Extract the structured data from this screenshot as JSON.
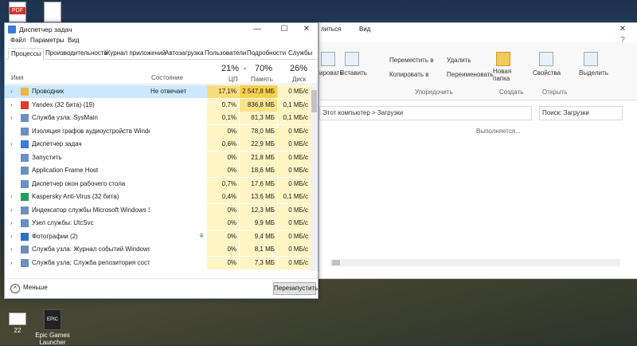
{
  "desktop": {
    "icons": [
      {
        "label": ""
      },
      {
        "label": ""
      },
      {
        "label": "22"
      },
      {
        "label": "Epic Games Launcher"
      }
    ]
  },
  "explorer": {
    "menu": {
      "file_tab": "литься",
      "view_tab": "Вид"
    },
    "ribbon": {
      "copy_path": "ировать",
      "paste": "Вставить",
      "move_to": "Переместить в",
      "copy_to": "Копировать в",
      "delete": "Удалить",
      "rename": "Переименовать",
      "new_folder": "Новая папка",
      "properties": "Свойства",
      "select": "Выделить",
      "group_organize": "Упорядочить",
      "group_create": "Создать",
      "group_open": "Открыть"
    },
    "address": "Этот компьютер  >  Загрузки",
    "search_placeholder": "Поиск: Загрузки",
    "status": "Выполняется..."
  },
  "taskmanager": {
    "title": "Диспетчер задач",
    "menu": [
      "Файл",
      "Параметры",
      "Вид"
    ],
    "tabs": [
      "Процессы",
      "Производительность",
      "Журнал приложений",
      "Автозагрузка",
      "Пользователи",
      "Подробности",
      "Службы"
    ],
    "columns": {
      "name": "Имя",
      "state": "Состояние",
      "cpu_pct": "21%",
      "cpu": "ЦП",
      "mem_pct": "70%",
      "mem": "Память",
      "disk_pct": "26%",
      "disk": "Диск"
    },
    "rows": [
      {
        "name": "Проводник",
        "state": "Не отвечает",
        "cpu": "17,1%",
        "mem": "2 547,8 МБ",
        "disk": "0 МБ/с",
        "arrow": "›",
        "color": "#e8b93a"
      },
      {
        "name": "Yandex (32 бита) (19)",
        "state": "",
        "cpu": "0,7%",
        "mem": "836,8 МБ",
        "disk": "0,1 МБ/с",
        "arrow": "›",
        "color": "#e03c2c"
      },
      {
        "name": "Служба узла: SysMain",
        "state": "",
        "cpu": "0,1%",
        "mem": "81,3 МБ",
        "disk": "0,1 МБ/с",
        "arrow": "›",
        "color": "#6b8fbf"
      },
      {
        "name": "Изоляция графов аудиоустройств Windows",
        "state": "",
        "cpu": "0%",
        "mem": "78,0 МБ",
        "disk": "0 МБ/с",
        "arrow": "",
        "color": "#6b8fbf"
      },
      {
        "name": "Диспетчер задач",
        "state": "",
        "cpu": "0,6%",
        "mem": "22,9 МБ",
        "disk": "0 МБ/с",
        "arrow": "›",
        "color": "#3a7bd5"
      },
      {
        "name": "Запустить",
        "state": "",
        "cpu": "0%",
        "mem": "21,8 МБ",
        "disk": "0 МБ/с",
        "arrow": "",
        "color": "#6b8fbf"
      },
      {
        "name": "Application Frame Host",
        "state": "",
        "cpu": "0%",
        "mem": "18,6 МБ",
        "disk": "0 МБ/с",
        "arrow": "",
        "color": "#6b8fbf"
      },
      {
        "name": "Диспетчер окон рабочего стола",
        "state": "",
        "cpu": "0,7%",
        "mem": "17,6 МБ",
        "disk": "0 МБ/с",
        "arrow": "",
        "color": "#6b8fbf"
      },
      {
        "name": "Kaspersky Anti-Virus (32 бита)",
        "state": "",
        "cpu": "0,4%",
        "mem": "13,6 МБ",
        "disk": "0,1 МБ/с",
        "arrow": "›",
        "color": "#2a9a5a"
      },
      {
        "name": "Индексатор службы Microsoft Windows Se...",
        "state": "",
        "cpu": "0%",
        "mem": "12,3 МБ",
        "disk": "0 МБ/с",
        "arrow": "›",
        "color": "#6b8fbf"
      },
      {
        "name": "Узел службы: UtcSvc",
        "state": "",
        "cpu": "0%",
        "mem": "9,9 МБ",
        "disk": "0 МБ/с",
        "arrow": "›",
        "color": "#6b8fbf"
      },
      {
        "name": "Фотографии (2)",
        "state": "",
        "cpu": "0%",
        "mem": "9,4 МБ",
        "disk": "0 МБ/с",
        "arrow": "›",
        "color": "#2f6fc4",
        "leaf": "⚘"
      },
      {
        "name": "Служба узла: Журнал событий Windows",
        "state": "",
        "cpu": "0%",
        "mem": "8,1 МБ",
        "disk": "0 МБ/с",
        "arrow": "›",
        "color": "#6b8fbf"
      },
      {
        "name": "Служба узла: Служба репозитория состов...",
        "state": "",
        "cpu": "0%",
        "mem": "7,3 МБ",
        "disk": "0 МБ/с",
        "arrow": "›",
        "color": "#6b8fbf"
      }
    ],
    "footer": {
      "less": "Меньше",
      "restart": "Перезапустить"
    }
  }
}
